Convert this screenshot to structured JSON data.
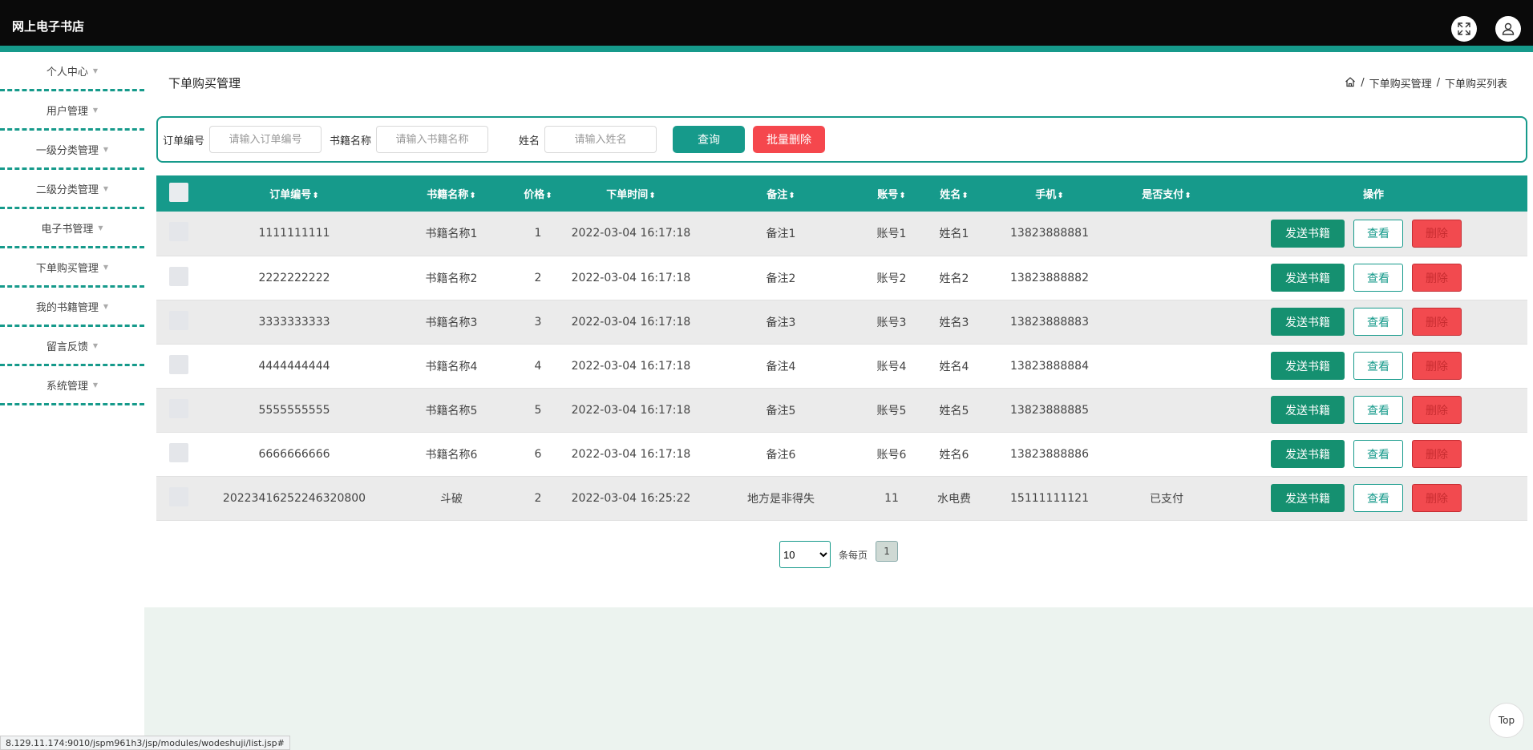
{
  "app": {
    "title": "网上电子书店"
  },
  "sidebar": {
    "items": [
      {
        "label": "个人中心"
      },
      {
        "label": "用户管理"
      },
      {
        "label": "一级分类管理"
      },
      {
        "label": "二级分类管理"
      },
      {
        "label": "电子书管理"
      },
      {
        "label": "下单购买管理"
      },
      {
        "label": "我的书籍管理"
      },
      {
        "label": "留言反馈"
      },
      {
        "label": "系统管理"
      }
    ]
  },
  "page": {
    "title": "下单购买管理",
    "breadcrumb": [
      "下单购买管理",
      "下单购买列表"
    ],
    "breadcrumb_sep": "/"
  },
  "search": {
    "order_no_label": "订单编号",
    "order_no_placeholder": "请输入订单编号",
    "book_name_label": "书籍名称",
    "book_name_placeholder": "请输入书籍名称",
    "name_label": "姓名",
    "name_placeholder": "请输入姓名",
    "query_label": "查询",
    "batch_delete_label": "批量删除"
  },
  "table": {
    "columns": [
      "订单编号",
      "书籍名称",
      "价格",
      "下单时间",
      "备注",
      "账号",
      "姓名",
      "手机",
      "是否支付",
      "操作"
    ],
    "sort_glyph": "⬍",
    "rows": [
      {
        "order_no": "1111111111",
        "book": "书籍名称1",
        "price": "1",
        "time": "2022-03-04 16:17:18",
        "note": "备注1",
        "account": "账号1",
        "name": "姓名1",
        "phone": "13823888881",
        "paid": ""
      },
      {
        "order_no": "2222222222",
        "book": "书籍名称2",
        "price": "2",
        "time": "2022-03-04 16:17:18",
        "note": "备注2",
        "account": "账号2",
        "name": "姓名2",
        "phone": "13823888882",
        "paid": ""
      },
      {
        "order_no": "3333333333",
        "book": "书籍名称3",
        "price": "3",
        "time": "2022-03-04 16:17:18",
        "note": "备注3",
        "account": "账号3",
        "name": "姓名3",
        "phone": "13823888883",
        "paid": ""
      },
      {
        "order_no": "4444444444",
        "book": "书籍名称4",
        "price": "4",
        "time": "2022-03-04 16:17:18",
        "note": "备注4",
        "account": "账号4",
        "name": "姓名4",
        "phone": "13823888884",
        "paid": ""
      },
      {
        "order_no": "5555555555",
        "book": "书籍名称5",
        "price": "5",
        "time": "2022-03-04 16:17:18",
        "note": "备注5",
        "account": "账号5",
        "name": "姓名5",
        "phone": "13823888885",
        "paid": ""
      },
      {
        "order_no": "6666666666",
        "book": "书籍名称6",
        "price": "6",
        "time": "2022-03-04 16:17:18",
        "note": "备注6",
        "account": "账号6",
        "name": "姓名6",
        "phone": "13823888886",
        "paid": ""
      },
      {
        "order_no": "20223416252246320800",
        "book": "斗破",
        "price": "2",
        "time": "2022-03-04 16:25:22",
        "note": "地方是非得失",
        "account": "11",
        "name": "水电费",
        "phone": "15111111121",
        "paid": "已支付"
      }
    ],
    "actions": {
      "send": "发送书籍",
      "view": "查看",
      "delete": "删除"
    }
  },
  "pagination": {
    "page_size": "10",
    "page_size_options": [
      "10"
    ],
    "per_page_label": "条每页",
    "current_page": "1"
  },
  "top_button": "Top",
  "status_url": "8.129.11.174:9010/jspm961h3/jsp/modules/wodeshuji/list.jsp#",
  "colors": {
    "accent": "#169a8b",
    "danger": "#f5474d",
    "send": "#159070"
  }
}
